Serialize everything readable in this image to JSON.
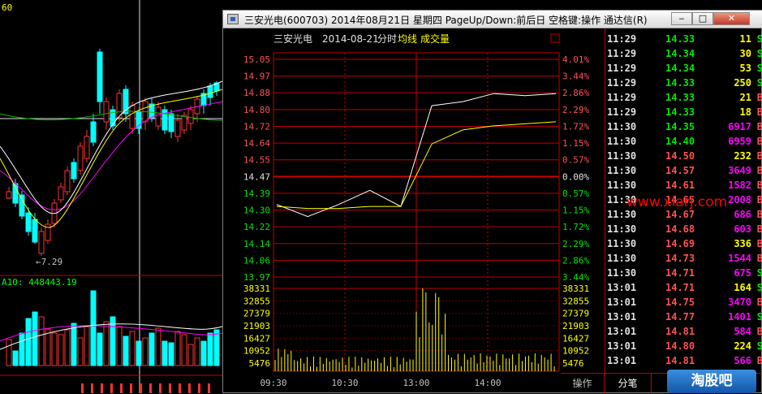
{
  "background_chart": {
    "ma_label": "60",
    "ma10_label": "",
    "volume_label": "A10: 448443.19",
    "low_label": "←7.29"
  },
  "window": {
    "title": "三安光电(600703) 2014年08月21日 星期四 PageUp/Down:前后日 空格键:操作 通达信(R)",
    "icon": "app-icon",
    "buttons": {
      "minimize": "‒",
      "maximize": "□",
      "close": "✕"
    }
  },
  "intraday": {
    "stock_name": "三安光电",
    "date": "2014-08-21",
    "mode": "分时",
    "avg_label": "均线",
    "vol_label": "成交量",
    "corner_box": "口",
    "price_ticks": [
      "15.05",
      "14.97",
      "14.88",
      "14.80",
      "14.72",
      "14.64",
      "14.55",
      "14.47",
      "14.39",
      "14.30",
      "14.22",
      "14.14",
      "14.06",
      "13.97"
    ],
    "pct_ticks": [
      "4.01%",
      "3.44%",
      "2.86%",
      "2.29%",
      "1.72%",
      "1.15%",
      "0.57%",
      "0.00%",
      "0.57%",
      "1.15%",
      "1.72%",
      "2.29%",
      "2.86%",
      "3.44%"
    ],
    "vol_ticks": [
      "38331",
      "32855",
      "27379",
      "21903",
      "16427",
      "10952",
      "5476"
    ],
    "time_ticks": [
      "09:30",
      "10:30",
      "13:00",
      "14:00"
    ],
    "colors": {
      "price_line": "#ffffff",
      "avg_line": "#ffff00",
      "grid": "#c00000",
      "up": "#ff5252",
      "down": "#00e600",
      "volume": "#ffff00"
    }
  },
  "chart_data": {
    "type": "line",
    "title": "三安光电 2014-08-21 分时",
    "xlabel": "",
    "ylabel": "",
    "ylim": [
      13.97,
      15.05
    ],
    "x": [
      "09:30",
      "10:00",
      "10:30",
      "11:00",
      "11:30",
      "13:00",
      "13:30",
      "14:00",
      "14:30",
      "15:00"
    ],
    "series": [
      {
        "name": "",
        "values": [
          14.33,
          14.27,
          14.33,
          14.4,
          14.32,
          14.82,
          14.84,
          14.88,
          14.87,
          14.88
        ]
      },
      {
        "name": "均线",
        "values": [
          14.32,
          14.31,
          14.31,
          14.32,
          14.32,
          14.63,
          14.7,
          14.72,
          14.73,
          14.74
        ]
      }
    ]
  },
  "ticks": [
    {
      "time": "11:29",
      "price": "14.33",
      "pc": "dn",
      "vol": "11",
      "vc": "vb",
      "side": "S",
      "sc": "dn"
    },
    {
      "time": "11:29",
      "price": "14.34",
      "pc": "dn",
      "vol": "30",
      "vc": "vb",
      "side": "S",
      "sc": "dn"
    },
    {
      "time": "11:29",
      "price": "14.34",
      "pc": "dn",
      "vol": "53",
      "vc": "vb",
      "side": "S",
      "sc": "dn"
    },
    {
      "time": "11:29",
      "price": "14.33",
      "pc": "dn",
      "vol": "250",
      "vc": "vb",
      "side": "S",
      "sc": "dn"
    },
    {
      "time": "11:29",
      "price": "14.33",
      "pc": "dn",
      "vol": "21",
      "vc": "vb",
      "side": "B",
      "sc": "up"
    },
    {
      "time": "11:29",
      "price": "14.33",
      "pc": "dn",
      "vol": "18",
      "vc": "vb",
      "side": "B",
      "sc": "up"
    },
    {
      "time": "11:30",
      "price": "14.35",
      "pc": "dn",
      "vol": "6917",
      "vc": "vs",
      "side": "B",
      "sc": "up"
    },
    {
      "time": "11:30",
      "price": "14.40",
      "pc": "dn",
      "vol": "6959",
      "vc": "vs",
      "side": "B",
      "sc": "up"
    },
    {
      "time": "11:30",
      "price": "14.50",
      "pc": "up",
      "vol": "232",
      "vc": "vb",
      "side": "B",
      "sc": "up"
    },
    {
      "time": "11:30",
      "price": "14.57",
      "pc": "up",
      "vol": "3649",
      "vc": "vs",
      "side": "B",
      "sc": "up"
    },
    {
      "time": "11:30",
      "price": "14.61",
      "pc": "up",
      "vol": "1582",
      "vc": "vs",
      "side": "B",
      "sc": "up"
    },
    {
      "time": "11:30",
      "price": "14.65",
      "pc": "up",
      "vol": "2008",
      "vc": "vs",
      "side": "B",
      "sc": "up"
    },
    {
      "time": "11:30",
      "price": "14.67",
      "pc": "up",
      "vol": "686",
      "vc": "vs",
      "side": "B",
      "sc": "up"
    },
    {
      "time": "11:30",
      "price": "14.68",
      "pc": "up",
      "vol": "603",
      "vc": "vs",
      "side": "B",
      "sc": "up"
    },
    {
      "time": "11:30",
      "price": "14.69",
      "pc": "up",
      "vol": "336",
      "vc": "vb",
      "side": "B",
      "sc": "up"
    },
    {
      "time": "11:30",
      "price": "14.73",
      "pc": "up",
      "vol": "1544",
      "vc": "vs",
      "side": "B",
      "sc": "up"
    },
    {
      "time": "11:30",
      "price": "14.71",
      "pc": "up",
      "vol": "675",
      "vc": "vs",
      "side": "S",
      "sc": "dn"
    },
    {
      "time": "13:01",
      "price": "14.71",
      "pc": "up",
      "vol": "164",
      "vc": "vb",
      "side": "S",
      "sc": "dn"
    },
    {
      "time": "13:01",
      "price": "14.75",
      "pc": "up",
      "vol": "3470",
      "vc": "vs",
      "side": "B",
      "sc": "up"
    },
    {
      "time": "13:01",
      "price": "14.77",
      "pc": "up",
      "vol": "1401",
      "vc": "vs",
      "side": "S",
      "sc": "dn"
    },
    {
      "time": "13:01",
      "price": "14.81",
      "pc": "up",
      "vol": "584",
      "vc": "vs",
      "side": "B",
      "sc": "up"
    },
    {
      "time": "13:01",
      "price": "14.80",
      "pc": "up",
      "vol": "224",
      "vc": "vb",
      "side": "S",
      "sc": "dn"
    },
    {
      "time": "13:01",
      "price": "14.81",
      "pc": "up",
      "vol": "566",
      "vc": "vs",
      "side": "B",
      "sc": "up"
    }
  ],
  "watermark": "www.xiarj.com",
  "tabs": {
    "operate": "操作",
    "ticks": "分笔",
    "minute": "分钟",
    "extra": "数据"
  },
  "logo": "淘股吧"
}
